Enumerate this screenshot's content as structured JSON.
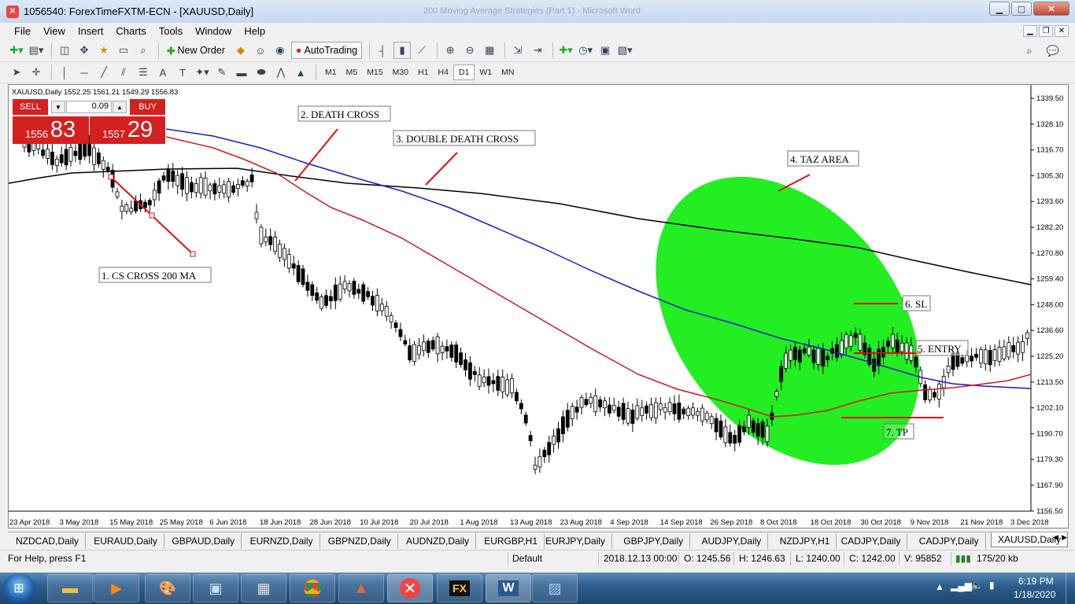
{
  "window": {
    "title": "1056540: ForexTimeFXTM-ECN - [XAUUSD,Daily]",
    "background_title": "200 Moving Average Strategies (Part 1) - Microsoft Word"
  },
  "menu": [
    "File",
    "View",
    "Insert",
    "Charts",
    "Tools",
    "Window",
    "Help"
  ],
  "toolbar": {
    "new_order": "New Order",
    "autotrading": "AutoTrading",
    "timeframes": [
      "M1",
      "M5",
      "M15",
      "M30",
      "H1",
      "H4",
      "D1",
      "W1",
      "MN"
    ],
    "active_timeframe": "D1"
  },
  "chart": {
    "symbol_header": "XAUUSD,Daily  1552.25 1561.21 1549.29 1556.83",
    "trade_panel": {
      "sell_label": "SELL",
      "buy_label": "BUY",
      "lot": "0.09",
      "sell_price_small": "1556",
      "sell_price_big": "83",
      "buy_price_small": "1557",
      "buy_price_big": "29"
    },
    "annotations": {
      "a1": "1. CS CROSS 200 MA",
      "a2": "2. DEATH CROSS",
      "a3": "3. DOUBLE DEATH CROSS",
      "a4": "4. TAZ AREA",
      "a5": "5. ENTRY",
      "a6": "6. SL",
      "a7": "7. TP"
    },
    "y_ticks": [
      "1339.50",
      "1328.10",
      "1316.70",
      "1305.30",
      "1293.60",
      "1282.20",
      "1270.80",
      "1259.40",
      "1248.00",
      "1236.60",
      "1225.20",
      "1213.50",
      "1202.10",
      "1190.70",
      "1179.30",
      "1167.90",
      "1156.50"
    ],
    "x_ticks": [
      "23 Apr 2018",
      "3 May 2018",
      "15 May 2018",
      "25 May 2018",
      "6 Jun 2018",
      "18 Jun 2018",
      "28 Jun 2018",
      "10 Jul 2018",
      "20 Jul 2018",
      "1 Aug 2018",
      "13 Aug 2018",
      "23 Aug 2018",
      "4 Sep 2018",
      "14 Sep 2018",
      "26 Sep 2018",
      "8 Oct 2018",
      "18 Oct 2018",
      "30 Oct 2018",
      "9 Nov 2018",
      "21 Nov 2018",
      "3 Dec 2018"
    ],
    "colors": {
      "ma_200": "#000000",
      "ma_100": "#1a1acc",
      "ma_50": "#cc1a1a",
      "taz_area": "#22ee22",
      "trade_panel": "#d42020",
      "annotation_line": "#dd1111"
    }
  },
  "tabs": [
    "NZDCAD,Daily",
    "EURAUD,Daily",
    "GBPAUD,Daily",
    "EURNZD,Daily",
    "GBPNZD,Daily",
    "AUDNZD,Daily",
    "EURGBP,H1",
    "EURJPY,Daily",
    "GBPJPY,Daily",
    "AUDJPY,Daily",
    "NZDJPY,H1",
    "CADJPY,Daily",
    "CADJPY,Daily",
    "XAUUSD,Daily"
  ],
  "active_tab": "XAUUSD,Daily",
  "status": {
    "help": "For Help, press F1",
    "profile": "Default",
    "datetime": "2018.12.13 00:00",
    "open": "O: 1245.56",
    "high": "H: 1246.63",
    "low": "L: 1240.00",
    "close": "C: 1242.00",
    "volume": "V: 95852",
    "traffic": "175/20 kb"
  },
  "taskbar": {
    "time": "6:19 PM",
    "date": "1/18/2020"
  }
}
